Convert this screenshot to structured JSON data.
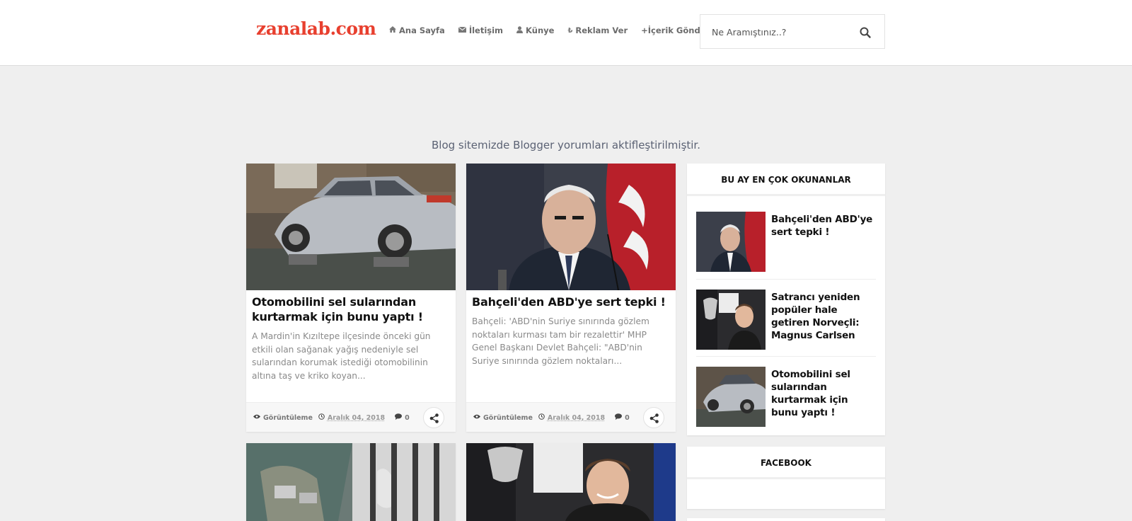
{
  "header": {
    "logo": "zanalab.com",
    "nav": [
      {
        "icon": "home-icon",
        "label": "Ana Sayfa"
      },
      {
        "icon": "envelope-icon",
        "label": "İletişim"
      },
      {
        "icon": "user-icon",
        "label": "Künye"
      },
      {
        "icon": "lira-icon",
        "label": "Reklam Ver"
      },
      {
        "icon": "plus-icon",
        "label": "+İçerik Gönder"
      }
    ],
    "search": {
      "placeholder": "Ne Aramıştınız..?"
    }
  },
  "notice": "Blog sitemizde Blogger yorumları aktifleştirilmiştir.",
  "posts": [
    {
      "title": "Otomobilini sel sularından kurtarmak için bunu yaptı !",
      "excerpt": "A Mardin'in Kızıltepe ilçesinde önceki gün etkili olan sağanak yağış nedeniyle sel sularından korumak istediği otomobilinin altına taş ve kriko koyan...",
      "views_label": "Görüntüleme",
      "date": "Aralık 04, 2018",
      "comments": "0"
    },
    {
      "title": "Bahçeli'den ABD'ye sert tepki !",
      "excerpt": "Bahçeli: 'ABD'nin Suriye sınırında gözlem noktaları kurması tam bir rezalettir' MHP Genel Başkanı Devlet Bahçeli: \"ABD'nin Suriye sınırında gözlem noktaları...",
      "views_label": "Görüntüleme",
      "date": "Aralık 04, 2018",
      "comments": "0"
    }
  ],
  "sidebar": {
    "popular": {
      "title": "BU AY EN ÇOK OKUNANLAR",
      "items": [
        {
          "title": "Bahçeli'den ABD'ye sert tepki !"
        },
        {
          "title": "Satrancı yeniden popüler hale getiren Norveçli: Magnus Carlsen"
        },
        {
          "title": "Otomobilini sel sularından kurtarmak için bunu yaptı !"
        }
      ]
    },
    "facebook": {
      "title": "FACEBOOK"
    }
  },
  "colors": {
    "brand": "#e8402f",
    "background": "#efefef",
    "notice_text": "#5b6274"
  }
}
